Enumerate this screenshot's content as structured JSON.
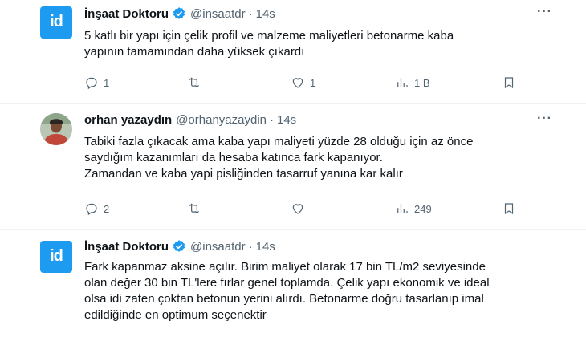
{
  "tweets": [
    {
      "author_name": "İnşaat Doktoru",
      "handle": "@insaatdr",
      "separator": "·",
      "time": "14s",
      "avatar_text": "id",
      "more": "···",
      "lines": [
        "5 katlı bir yapı için çelik profil ve malzeme maliyetleri betonarme kaba",
        "yapının tamamından daha yüksek çıkardı"
      ],
      "replies": "1",
      "retweets": "",
      "likes": "1",
      "views": "1 B"
    },
    {
      "author_name": "orhan yazaydın",
      "handle": "@orhanyazaydin",
      "separator": "·",
      "time": "14s",
      "more": "···",
      "lines": [
        "Tabiki fazla çıkacak ama kaba yapı maliyeti yüzde 28 olduğu için az önce",
        "saydığım kazanımları da hesaba katınca fark kapanıyor.",
        "Zamandan ve kaba yapi pisliğinden tasarruf yanına kar kalır"
      ],
      "replies": "2",
      "retweets": "",
      "likes": "",
      "views": "249"
    },
    {
      "author_name": "İnşaat Doktoru",
      "handle": "@insaatdr",
      "separator": "·",
      "time": "14s",
      "avatar_text": "id",
      "lines": [
        "Fark kapanmaz aksine açılır. Birim maliyet olarak 17 bin TL/m2 seviyesinde",
        "olan değer 30 bin TL'lere fırlar genel toplamda. Çelik yapı ekonomik ve ideal",
        "olsa idi zaten çoktan betonun yerini alırdı. Betonarme doğru tasarlanıp imal",
        "edildiğinde en optimum seçenektir"
      ]
    }
  ],
  "colors": {
    "accent": "#1d9bf0",
    "secondary_text": "#536471",
    "divider": "#eff3f4"
  },
  "icons": [
    "verified-badge-icon",
    "reply-icon",
    "retweet-icon",
    "like-icon",
    "views-icon",
    "bookmark-icon",
    "more-icon"
  ]
}
